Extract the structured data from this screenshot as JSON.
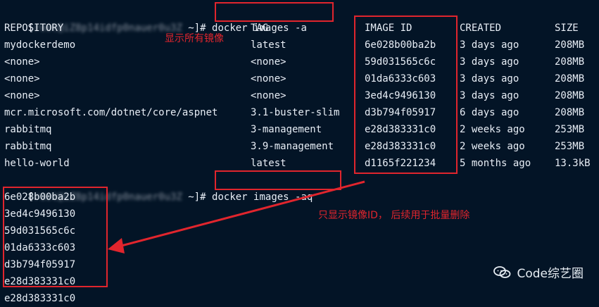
{
  "terminal": {
    "prompt1": {
      "prefix": "[",
      "masked_host": "root@iZ8p14idfp0nauer0u3Z",
      "suffix": " ~]# ",
      "command": "docker images -a"
    },
    "headers": [
      "REPOSITORY",
      "TAG",
      "IMAGE ID",
      "CREATED",
      "SIZE"
    ],
    "rows": [
      [
        "mydockerdemo",
        "latest",
        "6e028b00ba2b",
        "3 days ago",
        "208MB"
      ],
      [
        "<none>",
        "<none>",
        "59d031565c6c",
        "3 days ago",
        "208MB"
      ],
      [
        "<none>",
        "<none>",
        "01da6333c603",
        "3 days ago",
        "208MB"
      ],
      [
        "<none>",
        "<none>",
        "3ed4c9496130",
        "3 days ago",
        "208MB"
      ],
      [
        "mcr.microsoft.com/dotnet/core/aspnet",
        "3.1-buster-slim",
        "d3b794f05917",
        "6 days ago",
        "208MB"
      ],
      [
        "rabbitmq",
        "3-management",
        "e28d383331c0",
        "2 weeks ago",
        "253MB"
      ],
      [
        "rabbitmq",
        "3.9-management",
        "e28d383331c0",
        "2 weeks ago",
        "253MB"
      ],
      [
        "hello-world",
        "latest",
        "d1165f221234",
        "5 months ago",
        "13.3kB"
      ]
    ],
    "prompt2": {
      "prefix": "[",
      "masked_host": "root@iZ8p14idfp0nauer0u3Z",
      "suffix": " ~]# ",
      "command": "docker images -aq"
    },
    "ids": [
      "6e028b00ba2b",
      "3ed4c9496130",
      "59d031565c6c",
      "01da6333c603",
      "d3b794f05917",
      "e28d383331c0",
      "e28d383331c0"
    ]
  },
  "annotations": {
    "show_all": "显示所有镜像",
    "show_ids": "只显示镜像ID， 后续用于批量删除"
  },
  "watermark": {
    "text": "Code综艺圈",
    "icon": "wechat-icon"
  },
  "colors": {
    "background": "#031426",
    "text": "#e8eef6",
    "annotation": "#e1252d"
  }
}
